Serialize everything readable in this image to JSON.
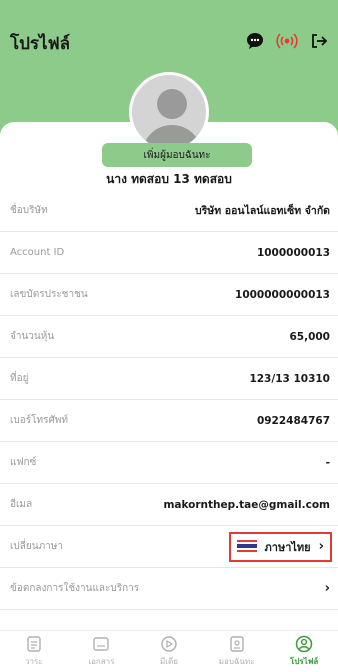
{
  "header": {
    "title": "โปรไฟล์",
    "bg_color": "#8dcb8a",
    "icons": [
      "chat-icon",
      "live-broadcast-icon",
      "logout-icon"
    ]
  },
  "profile": {
    "attorney_button": "เพิ่มผู้มอบฉันทะ",
    "name": "นาง ทดสอบ 13 ทดสอบ"
  },
  "rows": [
    {
      "label": "ชื่อบริษัท",
      "value": "บริษัท ออนไลน์แอทเซ็ท จำกัด"
    },
    {
      "label": "Account ID",
      "value": "1000000013"
    },
    {
      "label": "เลขบัตรประชาชน",
      "value": "1000000000013"
    },
    {
      "label": "จำนวนหุ้น",
      "value": "65,000"
    },
    {
      "label": "ที่อยู่",
      "value": "123/13 10310"
    },
    {
      "label": "เบอร์โทรศัพท์",
      "value": "0922484767"
    },
    {
      "label": "แฟกซ์",
      "value": "-"
    },
    {
      "label": "อีเมล",
      "value": "makornthep.tae@gmail.com"
    },
    {
      "label": "เปลี่ยนภาษา",
      "value": "ภาษาไทย"
    },
    {
      "label": "ข้อตกลงการใช้งานและบริการ",
      "value": ""
    }
  ],
  "nav": {
    "items": [
      {
        "label": "วาระ",
        "icon": "agenda-icon"
      },
      {
        "label": "เอกสาร",
        "icon": "document-icon"
      },
      {
        "label": "มีเดีย",
        "icon": "media-icon"
      },
      {
        "label": "มอบฉันทะ",
        "icon": "proxy-icon"
      },
      {
        "label": "โปรไฟล์",
        "icon": "profile-icon"
      }
    ],
    "active_color": "#3c9c3c"
  }
}
